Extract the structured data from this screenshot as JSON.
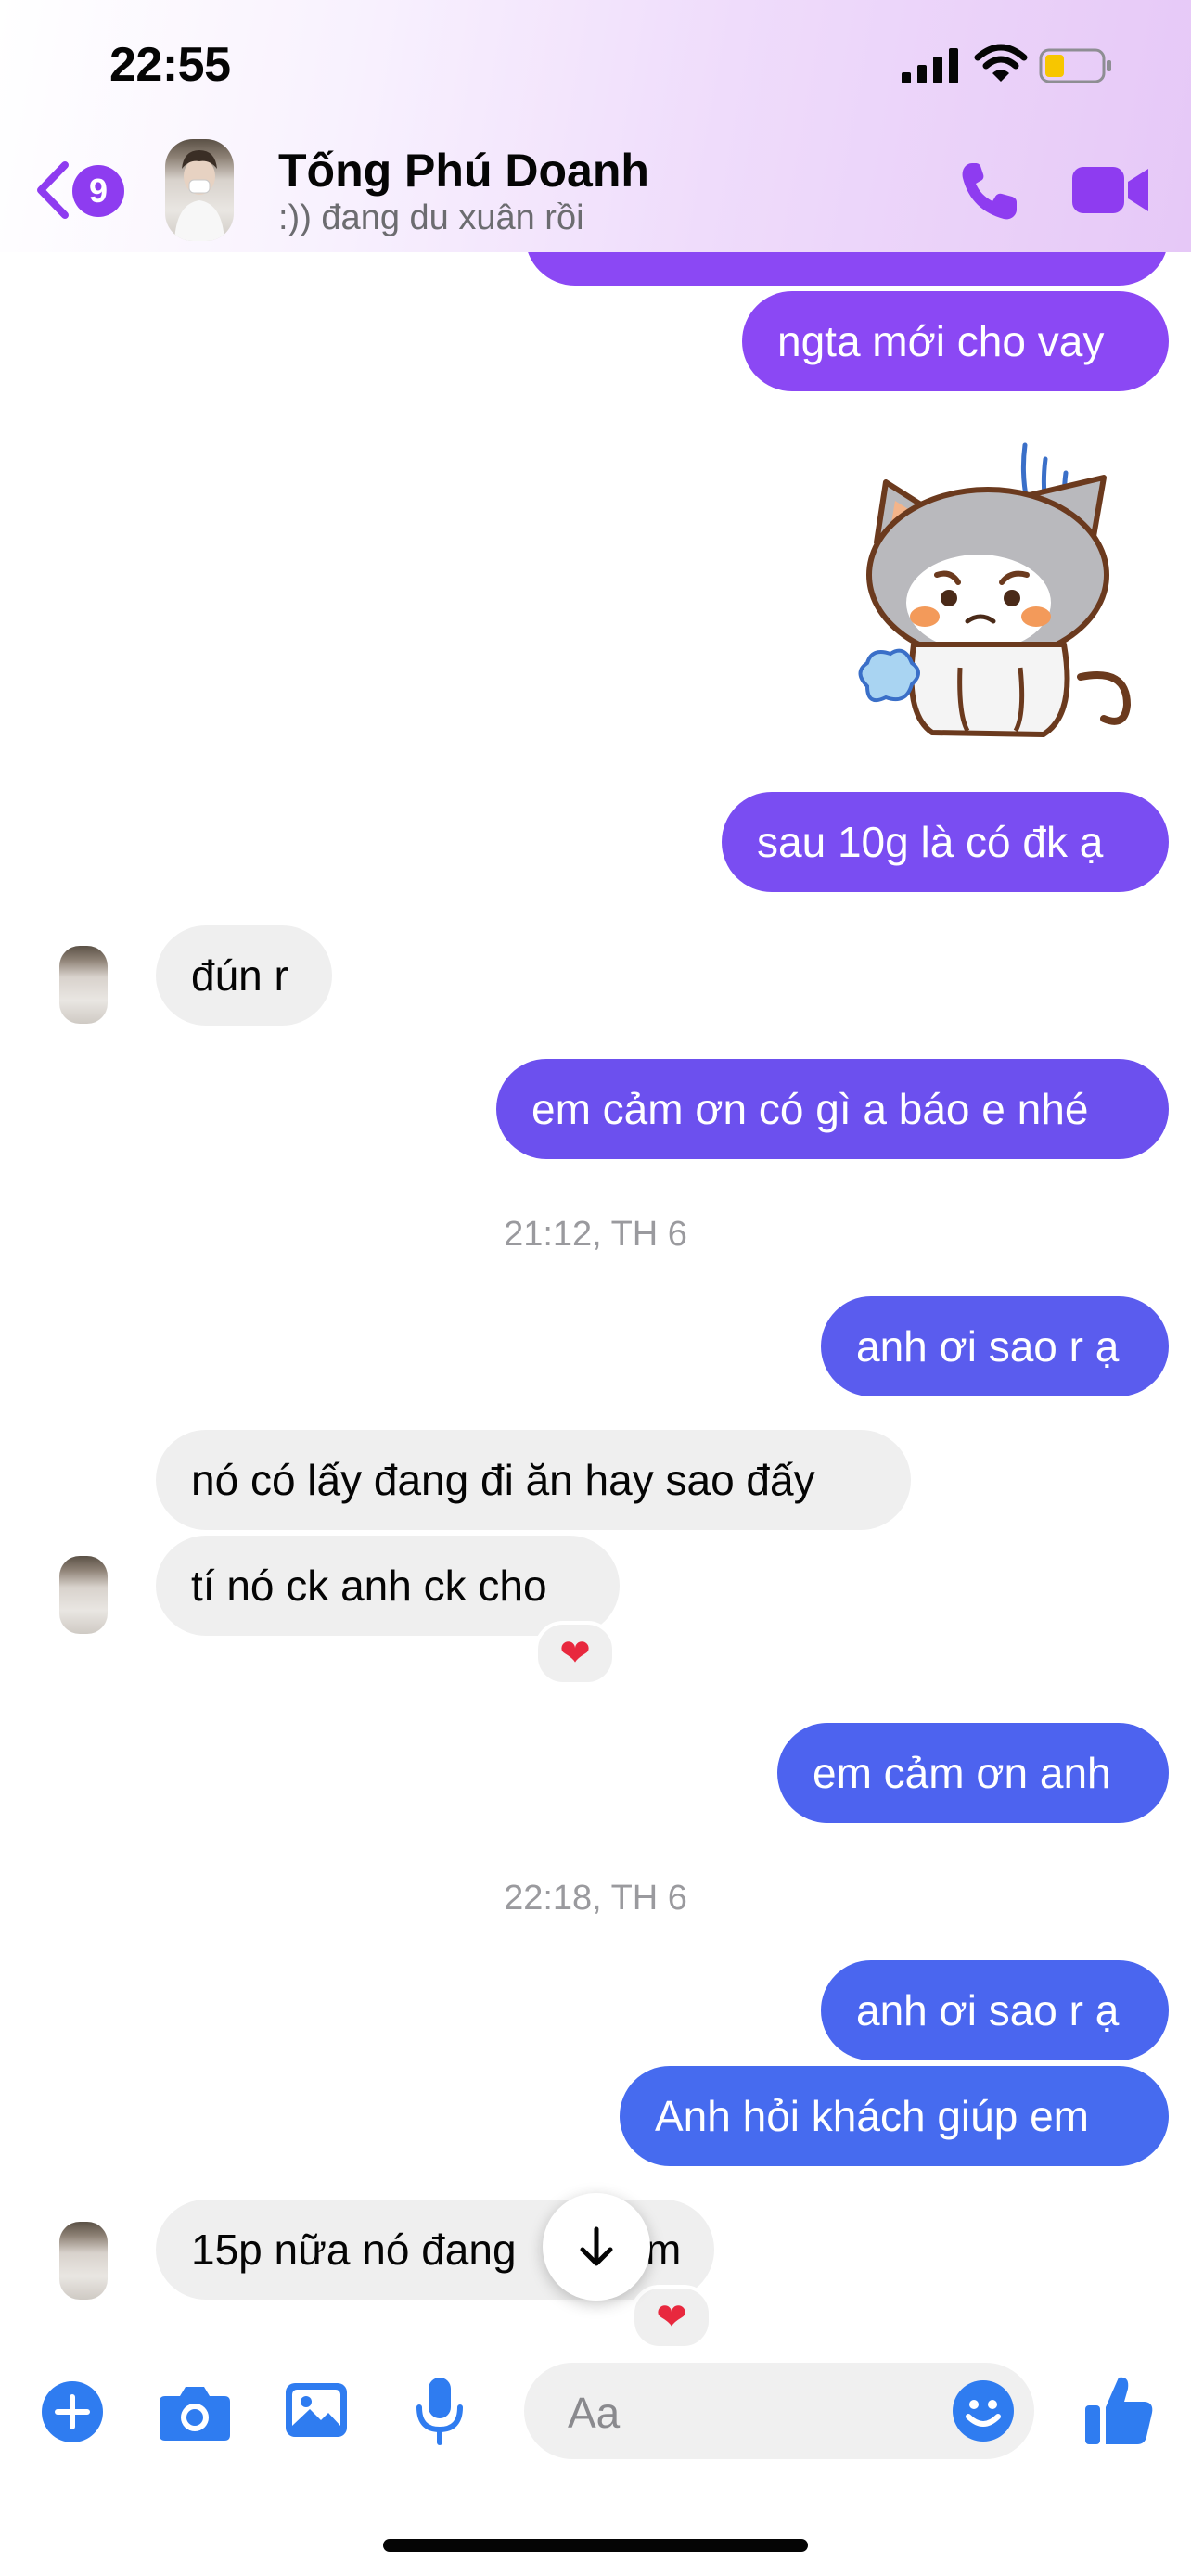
{
  "status_bar": {
    "time": "22:55"
  },
  "header": {
    "back_badge": "9",
    "contact_name": "Tống Phú Doanh",
    "contact_status": ":)) đang du xuân rồi",
    "accent": "#8e3cf0"
  },
  "colors": {
    "outgoing_purple": "#8b48f4",
    "outgoing_violet": "#6c50ee",
    "outgoing_blue": "#4d63ef",
    "incoming_bg": "#efefef",
    "messenger_blue": "#2f7cf0"
  },
  "messages": {
    "m1": "ngta mới cho vay",
    "m2": "sau 10g là có đk ạ",
    "m3": "đún r",
    "m4": "em cảm ơn có gì a báo e nhé",
    "t1": "21:12, TH 6",
    "m5": "anh ơi sao r ạ",
    "m6": "nó có lấy đang đi ăn hay sao đấy",
    "m7": "tí nó ck anh ck cho",
    "m8": "em cảm ơn anh",
    "t2": "22:18, TH 6",
    "m9": "anh ơi sao r ạ",
    "m10": "Anh hỏi khách giúp em",
    "m11": "15p nữa nó đang",
    "m11_tail": "m",
    "reaction": "❤"
  },
  "composer": {
    "placeholder": "Aa",
    "icons": [
      "plus-circle-icon",
      "camera-icon",
      "image-icon",
      "microphone-icon",
      "emoji-icon",
      "thumbs-up-icon"
    ]
  }
}
